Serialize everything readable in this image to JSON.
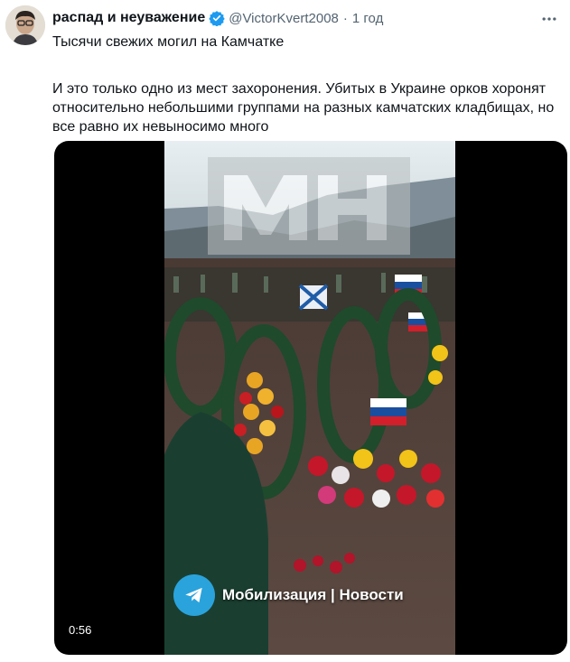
{
  "tweet": {
    "display_name": "распад и неуважение",
    "handle": "@VictorKvert2008",
    "separator": "·",
    "time": "1 год",
    "line1": "Тысячи свежих могил на Камчатке",
    "line2": "И это только одно из мест захоронения. Убитых в Украине орков хоронят относительно небольшими группами на разных камчатских кладбищах, но все равно их невыносимо много"
  },
  "video": {
    "duration": "0:56",
    "channel_badge": "Мобилизация | Новости",
    "watermark_logo": "MH"
  },
  "colors": {
    "verified": "#1d9bf0",
    "telegram": "#2aa3dc",
    "text": "#0f1419",
    "muted": "#536471"
  },
  "icons": [
    "avatar",
    "verified-badge-icon",
    "more-icon",
    "telegram-icon"
  ]
}
